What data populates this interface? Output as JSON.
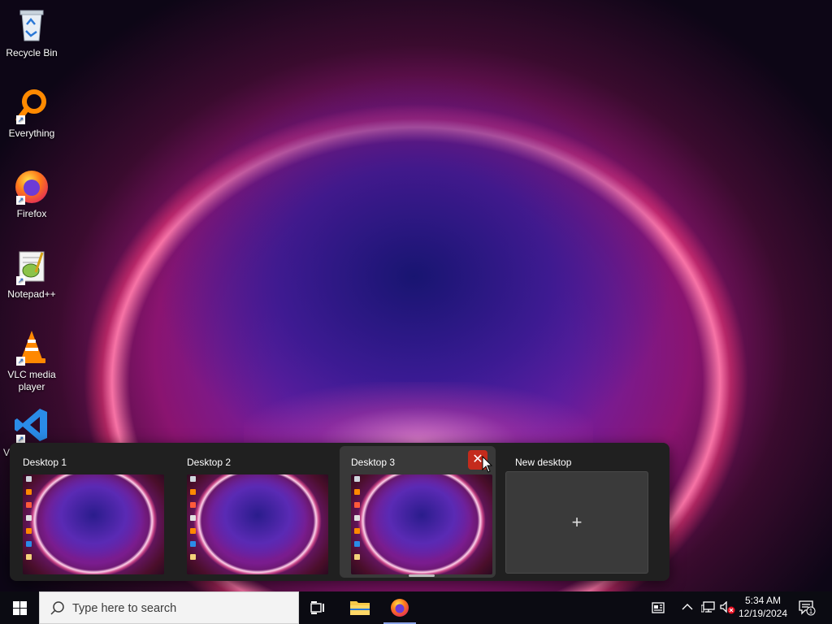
{
  "desktop": {
    "icons": [
      {
        "label": "Recycle Bin",
        "icon": "recycle-bin-icon"
      },
      {
        "label": "Everything",
        "icon": "everything-search-icon"
      },
      {
        "label": "Firefox",
        "icon": "firefox-icon"
      },
      {
        "label": "Notepad++",
        "icon": "notepad-plus-plus-icon"
      },
      {
        "label": "VLC media player",
        "icon": "vlc-icon"
      },
      {
        "label": "V",
        "icon": "vscode-icon"
      }
    ]
  },
  "task_view": {
    "desktops": [
      {
        "title": "Desktop 1"
      },
      {
        "title": "Desktop 2"
      },
      {
        "title": "Desktop 3",
        "selected": true
      }
    ],
    "new_desktop_label": "New desktop",
    "new_desktop_plus": "+",
    "close_glyph": "✕"
  },
  "taskbar": {
    "search_placeholder": "Type here to search",
    "pinned": [
      "task-view-icon",
      "file-explorer-icon",
      "firefox-icon"
    ],
    "tray": {
      "time": "5:34 AM",
      "date": "12/19/2024",
      "notification_count": "1"
    }
  },
  "colors": {
    "taskview_bg": "#202020",
    "close_red": "#c42b1c",
    "taskbar_bg": "#0b0b12",
    "accent": "#8aa2e6"
  }
}
